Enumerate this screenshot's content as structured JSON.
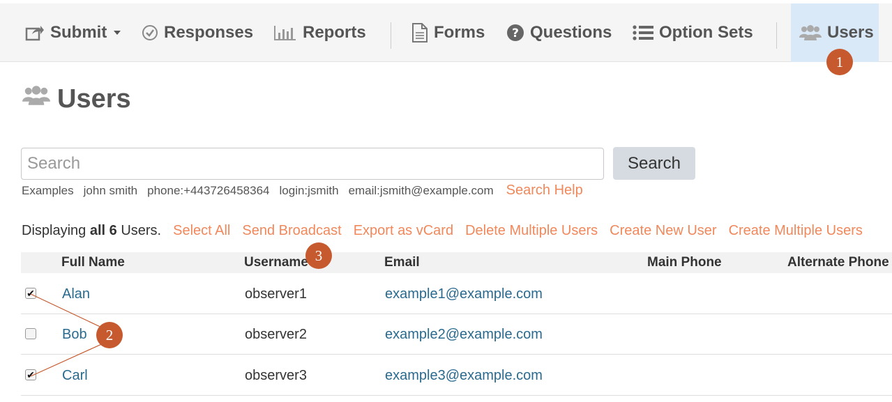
{
  "nav": {
    "submit": "Submit",
    "responses": "Responses",
    "reports": "Reports",
    "forms": "Forms",
    "questions": "Questions",
    "option_sets": "Option Sets",
    "users": "Users"
  },
  "page": {
    "title": "Users"
  },
  "search": {
    "placeholder": "Search",
    "button": "Search",
    "examples_label": "Examples",
    "examples": [
      "john smith",
      "phone:+443726458364",
      "login:jsmith",
      "email:jsmith@example.com"
    ],
    "help": "Search Help"
  },
  "listing": {
    "prefix": "Displaying",
    "all": "all 6",
    "suffix": "Users.",
    "actions": [
      "Select All",
      "Send Broadcast",
      "Export as vCard",
      "Delete Multiple Users",
      "Create New User",
      "Create Multiple Users"
    ]
  },
  "table": {
    "columns": [
      "Full Name",
      "Username",
      "Email",
      "Main Phone",
      "Alternate Phone"
    ],
    "rows": [
      {
        "checked": true,
        "name": "Alan",
        "username": "observer1",
        "email": "example1@example.com"
      },
      {
        "checked": false,
        "name": "Bob",
        "username": "observer2",
        "email": "example2@example.com"
      },
      {
        "checked": true,
        "name": "Carl",
        "username": "observer3",
        "email": "example3@example.com"
      }
    ]
  },
  "annotations": {
    "one": "1",
    "two": "2",
    "three": "3"
  },
  "colors": {
    "accent_link": "#f0885b",
    "badge": "#c65a2e",
    "active_nav": "#d9e9f7",
    "table_link": "#2a6a8e"
  }
}
